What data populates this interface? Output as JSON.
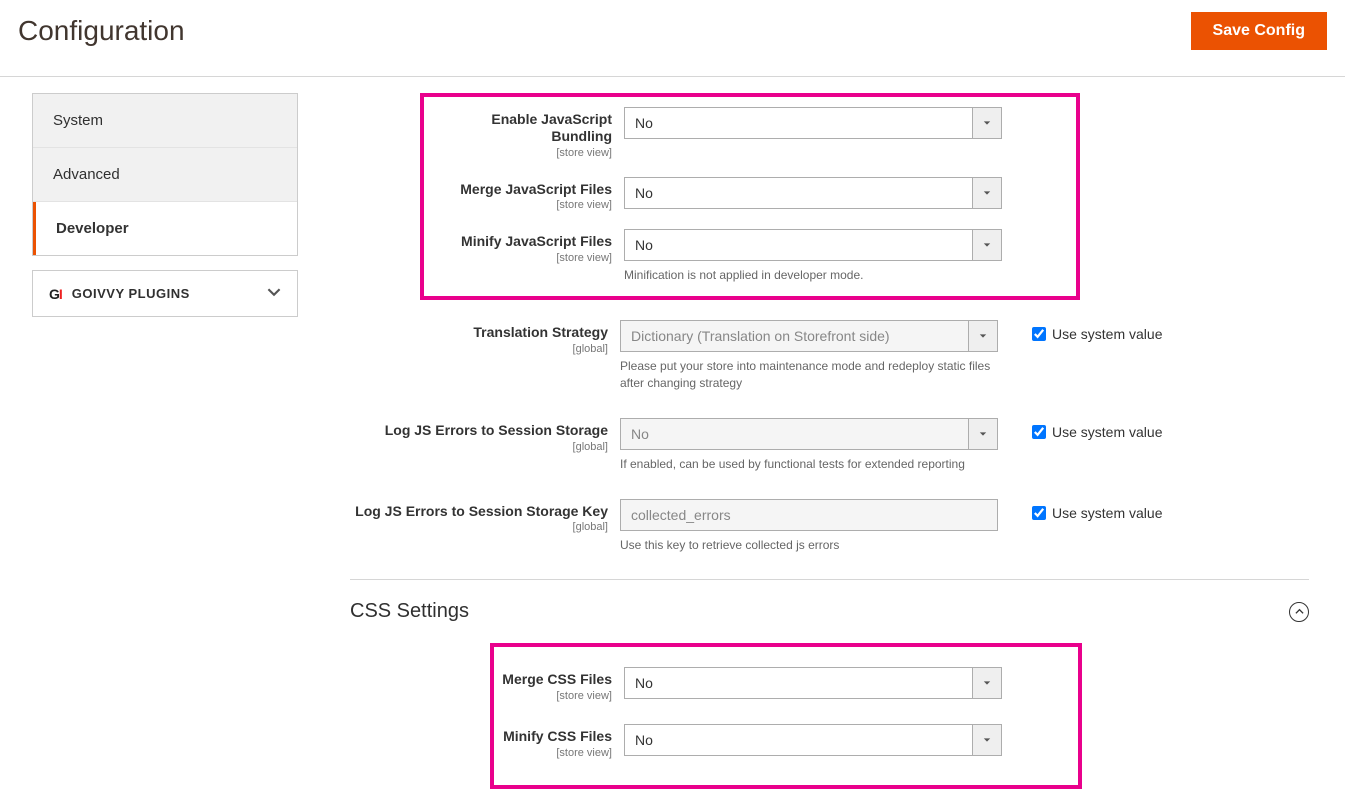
{
  "header": {
    "title": "Configuration",
    "save_button": "Save Config"
  },
  "sidebar": {
    "items": [
      {
        "label": "System",
        "id": "system"
      },
      {
        "label": "Advanced",
        "id": "advanced"
      },
      {
        "label": "Developer",
        "id": "developer",
        "active": true
      }
    ],
    "plugins_label": "GOIVVY PLUGINS"
  },
  "js_box": {
    "enable_bundling": {
      "label": "Enable JavaScript Bundling",
      "scope": "[store view]",
      "value": "No"
    },
    "merge_js": {
      "label": "Merge JavaScript Files",
      "scope": "[store view]",
      "value": "No"
    },
    "minify_js": {
      "label": "Minify JavaScript Files",
      "scope": "[store view]",
      "value": "No",
      "note": "Minification is not applied in developer mode."
    }
  },
  "fields": {
    "translation_strategy": {
      "label": "Translation Strategy",
      "scope": "[global]",
      "value": "Dictionary (Translation on Storefront side)",
      "note": "Please put your store into maintenance mode and redeploy static files after changing strategy",
      "use_system": "Use system value"
    },
    "log_js_errors": {
      "label": "Log JS Errors to Session Storage",
      "scope": "[global]",
      "value": "No",
      "note": "If enabled, can be used by functional tests for extended reporting",
      "use_system": "Use system value"
    },
    "log_js_key": {
      "label": "Log JS Errors to Session Storage Key",
      "scope": "[global]",
      "value": "collected_errors",
      "note": "Use this key to retrieve collected js errors",
      "use_system": "Use system value"
    }
  },
  "css_section": {
    "title": "CSS Settings",
    "merge_css": {
      "label": "Merge CSS Files",
      "scope": "[store view]",
      "value": "No"
    },
    "minify_css": {
      "label": "Minify CSS Files",
      "scope": "[store view]",
      "value": "No"
    }
  }
}
